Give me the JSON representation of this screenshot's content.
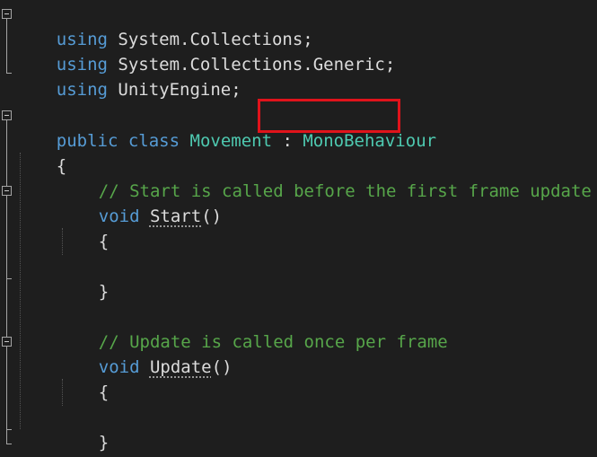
{
  "code": {
    "line1": {
      "kw": "using",
      "rest": " System.Collections;"
    },
    "line2": {
      "kw": "using",
      "rest": " System.Collections.Generic;"
    },
    "line3": {
      "kw": "using",
      "rest": " UnityEngine;"
    },
    "class_line": {
      "kw1": "public",
      "kw2": "class",
      "name": "Movement",
      "sep": " : ",
      "base": "MonoBehaviour"
    },
    "open_brace": "{",
    "comment_start": "// Start is called before the first frame update",
    "start_sig": {
      "kw": "void",
      "name": "Start",
      "parens": "()"
    },
    "start_open": "{",
    "start_close": "}",
    "comment_update": "// Update is called once per frame",
    "update_sig": {
      "kw": "void",
      "name": "Update",
      "parens": "()"
    },
    "update_open": "{",
    "update_close": "}",
    "close_brace": "}"
  },
  "colors": {
    "keyword": "#569cd6",
    "type": "#4ec9b0",
    "comment": "#57a64a",
    "text": "#dcdcdc",
    "highlight_box": "#e0131b",
    "background": "#1e1e1e"
  }
}
